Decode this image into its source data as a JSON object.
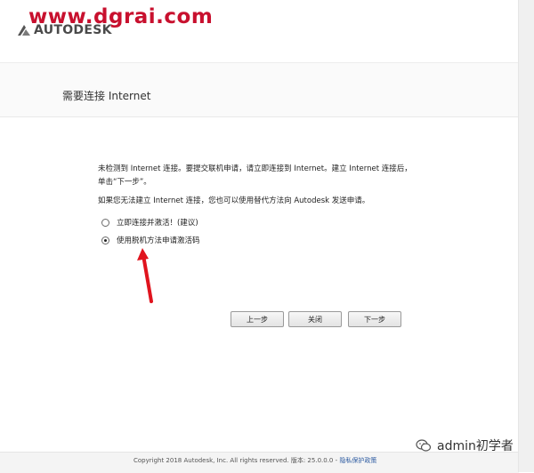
{
  "watermark": {
    "url_text": "www.dgrai.com"
  },
  "brand": {
    "logo_text": "AUTODESK"
  },
  "page": {
    "title": "需要连接 Internet"
  },
  "message": {
    "line1": "未检测到 Internet 连接。要提交联机申请，请立即连接到 Internet。建立 Internet 连接后，单击“下一步”。",
    "line2": "如果您无法建立 Internet 连接，您也可以使用替代方法向 Autodesk 发送申请。"
  },
  "options": [
    {
      "label": "立即连接并激活！(建议)",
      "checked": false
    },
    {
      "label": "使用脱机方法申请激活码",
      "checked": true
    }
  ],
  "buttons": {
    "back": "上一步",
    "close": "关闭",
    "next": "下一步"
  },
  "footer": {
    "copyright": "Copyright 2018 Autodesk, Inc. All rights reserved. 版本: 25.0.0.0 - ",
    "privacy_link": "隐私保护政策"
  },
  "overlay": {
    "wechat_label": "admin初学者"
  },
  "colors": {
    "watermark_red": "#c8102e",
    "arrow_red": "#e0141e",
    "link_blue": "#2c5aa0"
  }
}
